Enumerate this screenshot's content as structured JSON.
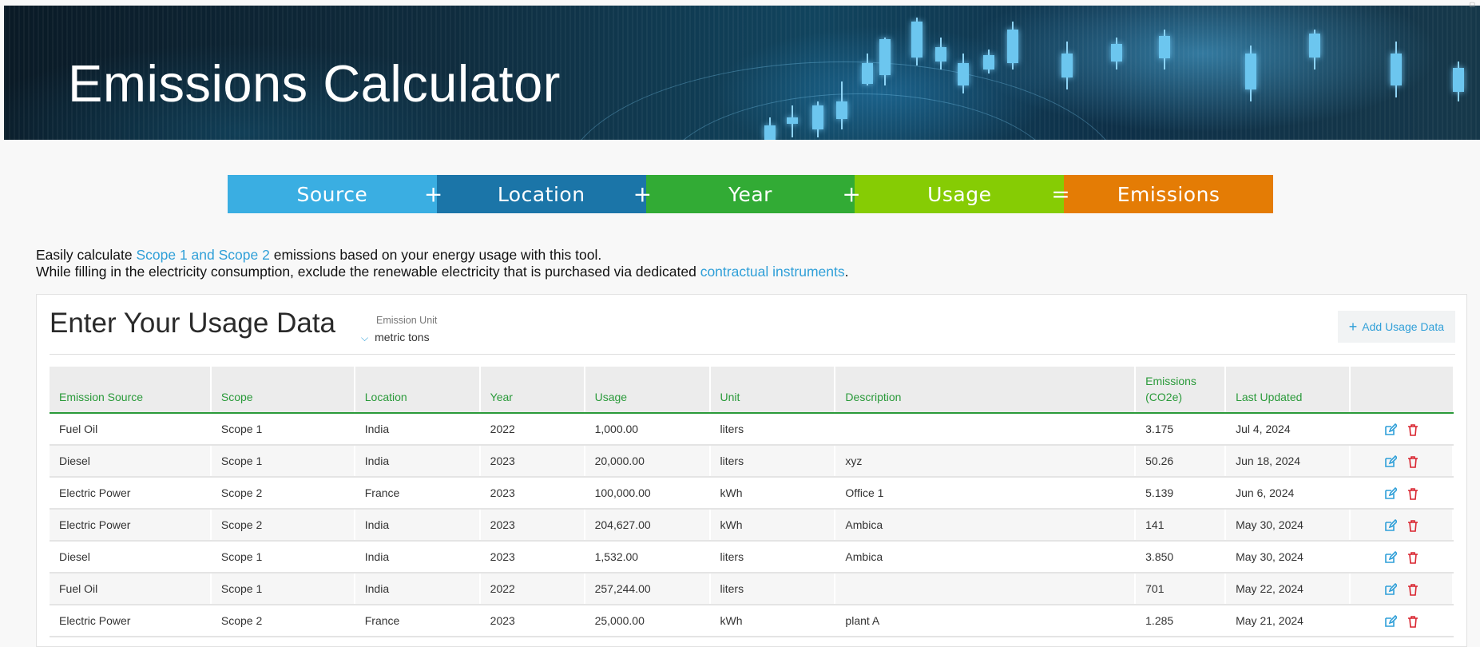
{
  "header": {
    "title": "Emissions Calculator"
  },
  "formula": {
    "segments": [
      {
        "label": "Source",
        "operator": "+",
        "color": "#3aaee2"
      },
      {
        "label": "Location",
        "operator": "+",
        "color": "#1b75a8"
      },
      {
        "label": "Year",
        "operator": "+",
        "color": "#32ab35"
      },
      {
        "label": "Usage",
        "operator": "=",
        "color": "#86cc04"
      },
      {
        "label": "Emissions",
        "operator": "",
        "color": "#e47c05"
      }
    ]
  },
  "intro": {
    "line1_pre": "Easily calculate ",
    "line1_link": "Scope 1 and Scope 2",
    "line1_post": " emissions based on your energy usage with this tool.",
    "line2_pre": "While filling in the electricity consumption, exclude the renewable electricity that is purchased via dedicated ",
    "line2_link": "contractual instruments",
    "line2_post": "."
  },
  "usage": {
    "title": "Enter Your Usage Data",
    "unit_label": "Emission Unit",
    "unit_value": "metric tons",
    "add_button": "Add Usage Data",
    "columns": [
      "Emission Source",
      "Scope",
      "Location",
      "Year",
      "Usage",
      "Unit",
      "Description",
      "Emissions (CO2e)",
      "Last Updated",
      ""
    ],
    "rows": [
      [
        "Fuel Oil",
        "Scope 1",
        "India",
        "2022",
        "1,000.00",
        "liters",
        "",
        "3.175",
        "Jul 4, 2024"
      ],
      [
        "Diesel",
        "Scope 1",
        "India",
        "2023",
        "20,000.00",
        "liters",
        "xyz",
        "50.26",
        "Jun 18, 2024"
      ],
      [
        "Electric Power",
        "Scope 2",
        "France",
        "2023",
        "100,000.00",
        "kWh",
        "Office 1",
        "5.139",
        "Jun 6, 2024"
      ],
      [
        "Electric Power",
        "Scope 2",
        "India",
        "2023",
        "204,627.00",
        "kWh",
        "Ambica",
        "141",
        "May 30, 2024"
      ],
      [
        "Diesel",
        "Scope 1",
        "India",
        "2023",
        "1,532.00",
        "liters",
        "Ambica",
        "3.850",
        "May 30, 2024"
      ],
      [
        "Fuel Oil",
        "Scope 1",
        "India",
        "2022",
        "257,244.00",
        "liters",
        "",
        "701",
        "May 22, 2024"
      ],
      [
        "Electric Power",
        "Scope 2",
        "France",
        "2023",
        "25,000.00",
        "kWh",
        "plant A",
        "1.285",
        "May 21, 2024"
      ]
    ]
  },
  "colors": {
    "accent": "#2f9fd8",
    "header_green": "#2a9a3a",
    "delete_red": "#d9232e"
  },
  "icons": {
    "edit": "edit-icon",
    "delete": "trash-icon",
    "add": "plus-icon",
    "dropdown": "chevron-down-icon"
  }
}
